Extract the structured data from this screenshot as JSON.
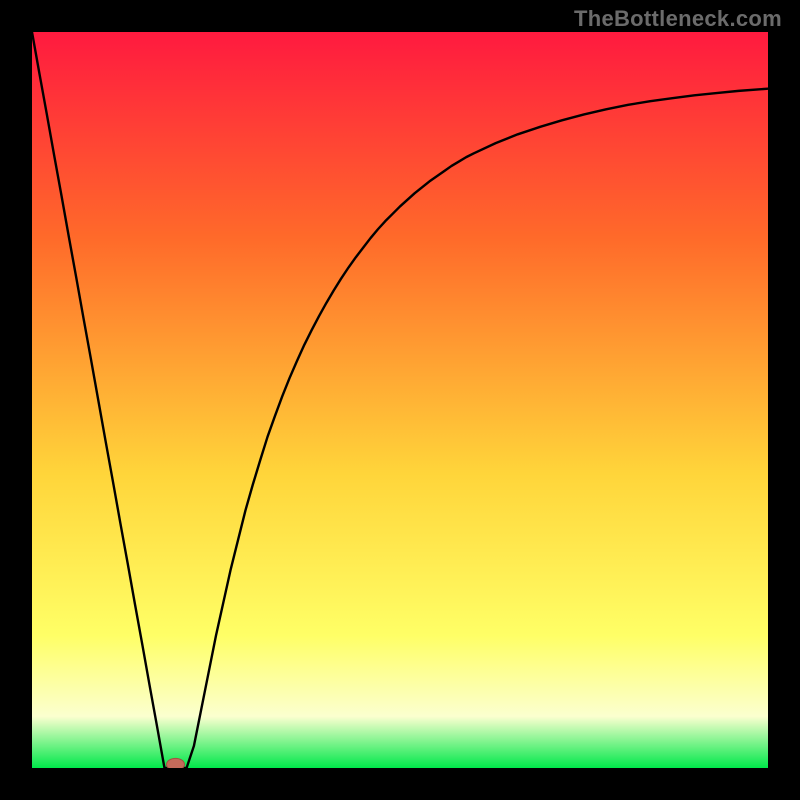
{
  "attribution": "TheBottleneck.com",
  "colors": {
    "frame": "#000000",
    "gradient_top": "#ff1a3f",
    "gradient_mid1": "#ff6a2a",
    "gradient_mid2": "#ffd53a",
    "gradient_mid3": "#ffff66",
    "gradient_mid4": "#fbffcf",
    "gradient_bottom": "#00e84a",
    "curve": "#000000",
    "marker_fill": "#c46a5a",
    "marker_stroke": "#a44f42"
  },
  "chart_data": {
    "type": "line",
    "title": "",
    "xlabel": "",
    "ylabel": "",
    "xlim": [
      0,
      100
    ],
    "ylim": [
      0,
      100
    ],
    "x": [
      0,
      1,
      2,
      3,
      4,
      5,
      6,
      7,
      8,
      9,
      10,
      11,
      12,
      13,
      14,
      15,
      16,
      17,
      18,
      19,
      20,
      21,
      22,
      23,
      24,
      25,
      26,
      27,
      28,
      29,
      30,
      31,
      32,
      33,
      34,
      35,
      36,
      37,
      38,
      39,
      40,
      41,
      42,
      43,
      44,
      45,
      46,
      47,
      48,
      49,
      50,
      51,
      52,
      53,
      54,
      55,
      56,
      57,
      58,
      59,
      60,
      63,
      66,
      69,
      72,
      75,
      78,
      81,
      84,
      87,
      90,
      93,
      96,
      100
    ],
    "y": [
      100,
      94.4,
      88.9,
      83.3,
      77.8,
      72.2,
      66.7,
      61.1,
      55.6,
      50.0,
      44.4,
      38.9,
      33.3,
      27.8,
      22.2,
      16.7,
      11.1,
      5.6,
      0.0,
      0.0,
      0.0,
      0.0,
      3.0,
      8.0,
      13.0,
      18.0,
      22.5,
      27.0,
      31.0,
      35.0,
      38.5,
      41.8,
      45.0,
      47.8,
      50.5,
      53.0,
      55.3,
      57.5,
      59.5,
      61.4,
      63.2,
      64.9,
      66.5,
      68.0,
      69.4,
      70.7,
      72.0,
      73.2,
      74.3,
      75.3,
      76.3,
      77.2,
      78.1,
      78.9,
      79.7,
      80.4,
      81.1,
      81.8,
      82.4,
      83.0,
      83.5,
      84.9,
      86.1,
      87.1,
      88.0,
      88.8,
      89.5,
      90.1,
      90.6,
      91.0,
      91.4,
      91.7,
      92.0,
      92.3
    ],
    "marker": {
      "x": 19.5,
      "y": 0.5,
      "shape": "ellipse"
    },
    "notes": "Axes unlabeled; gradient background from red (top) to green (bottom); single black curve with sharp V-notch near x≈19 and asymptotic rise toward ~92 at right edge."
  }
}
